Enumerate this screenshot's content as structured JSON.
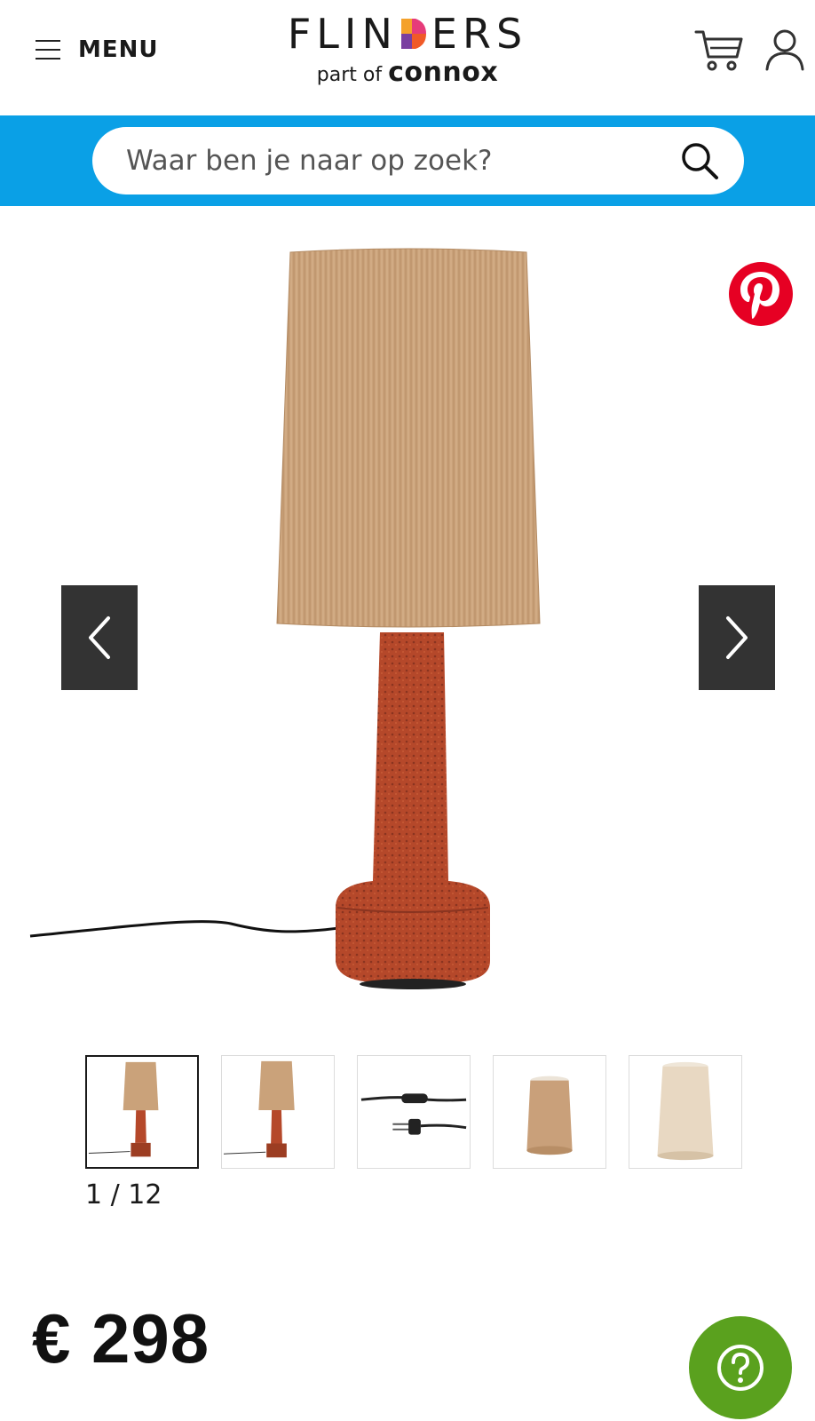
{
  "header": {
    "menu_label": "MENU",
    "brand_name_before": "FLIN",
    "brand_name_after": "ERS",
    "brand_sub_prefix": "part of",
    "brand_sub_name": "connox",
    "icons": [
      "menu-icon",
      "cart-icon",
      "user-icon"
    ]
  },
  "search": {
    "placeholder": "Waar ben je naar op zoek?",
    "value": "",
    "icon": "search-icon"
  },
  "gallery": {
    "current": 1,
    "total": 12,
    "counter_text": "1 / 12",
    "share_icon": "pinterest-icon",
    "thumbnails": [
      {
        "name": "lamp-full-view",
        "active": true
      },
      {
        "name": "lamp-full-view-alt",
        "active": false
      },
      {
        "name": "cable-switch-plug",
        "active": false
      },
      {
        "name": "lampshade-tan",
        "active": false
      },
      {
        "name": "lampshade-cream",
        "active": false
      }
    ]
  },
  "product": {
    "price": "€ 298"
  },
  "colors": {
    "search_band": "#0aa0e6",
    "nav_arrow_bg": "#333333",
    "help_button": "#5aa11e",
    "pinterest": "#e60023",
    "shade": "#c9a27a",
    "base": "#b94a28"
  },
  "help": {
    "icon": "question-icon"
  }
}
